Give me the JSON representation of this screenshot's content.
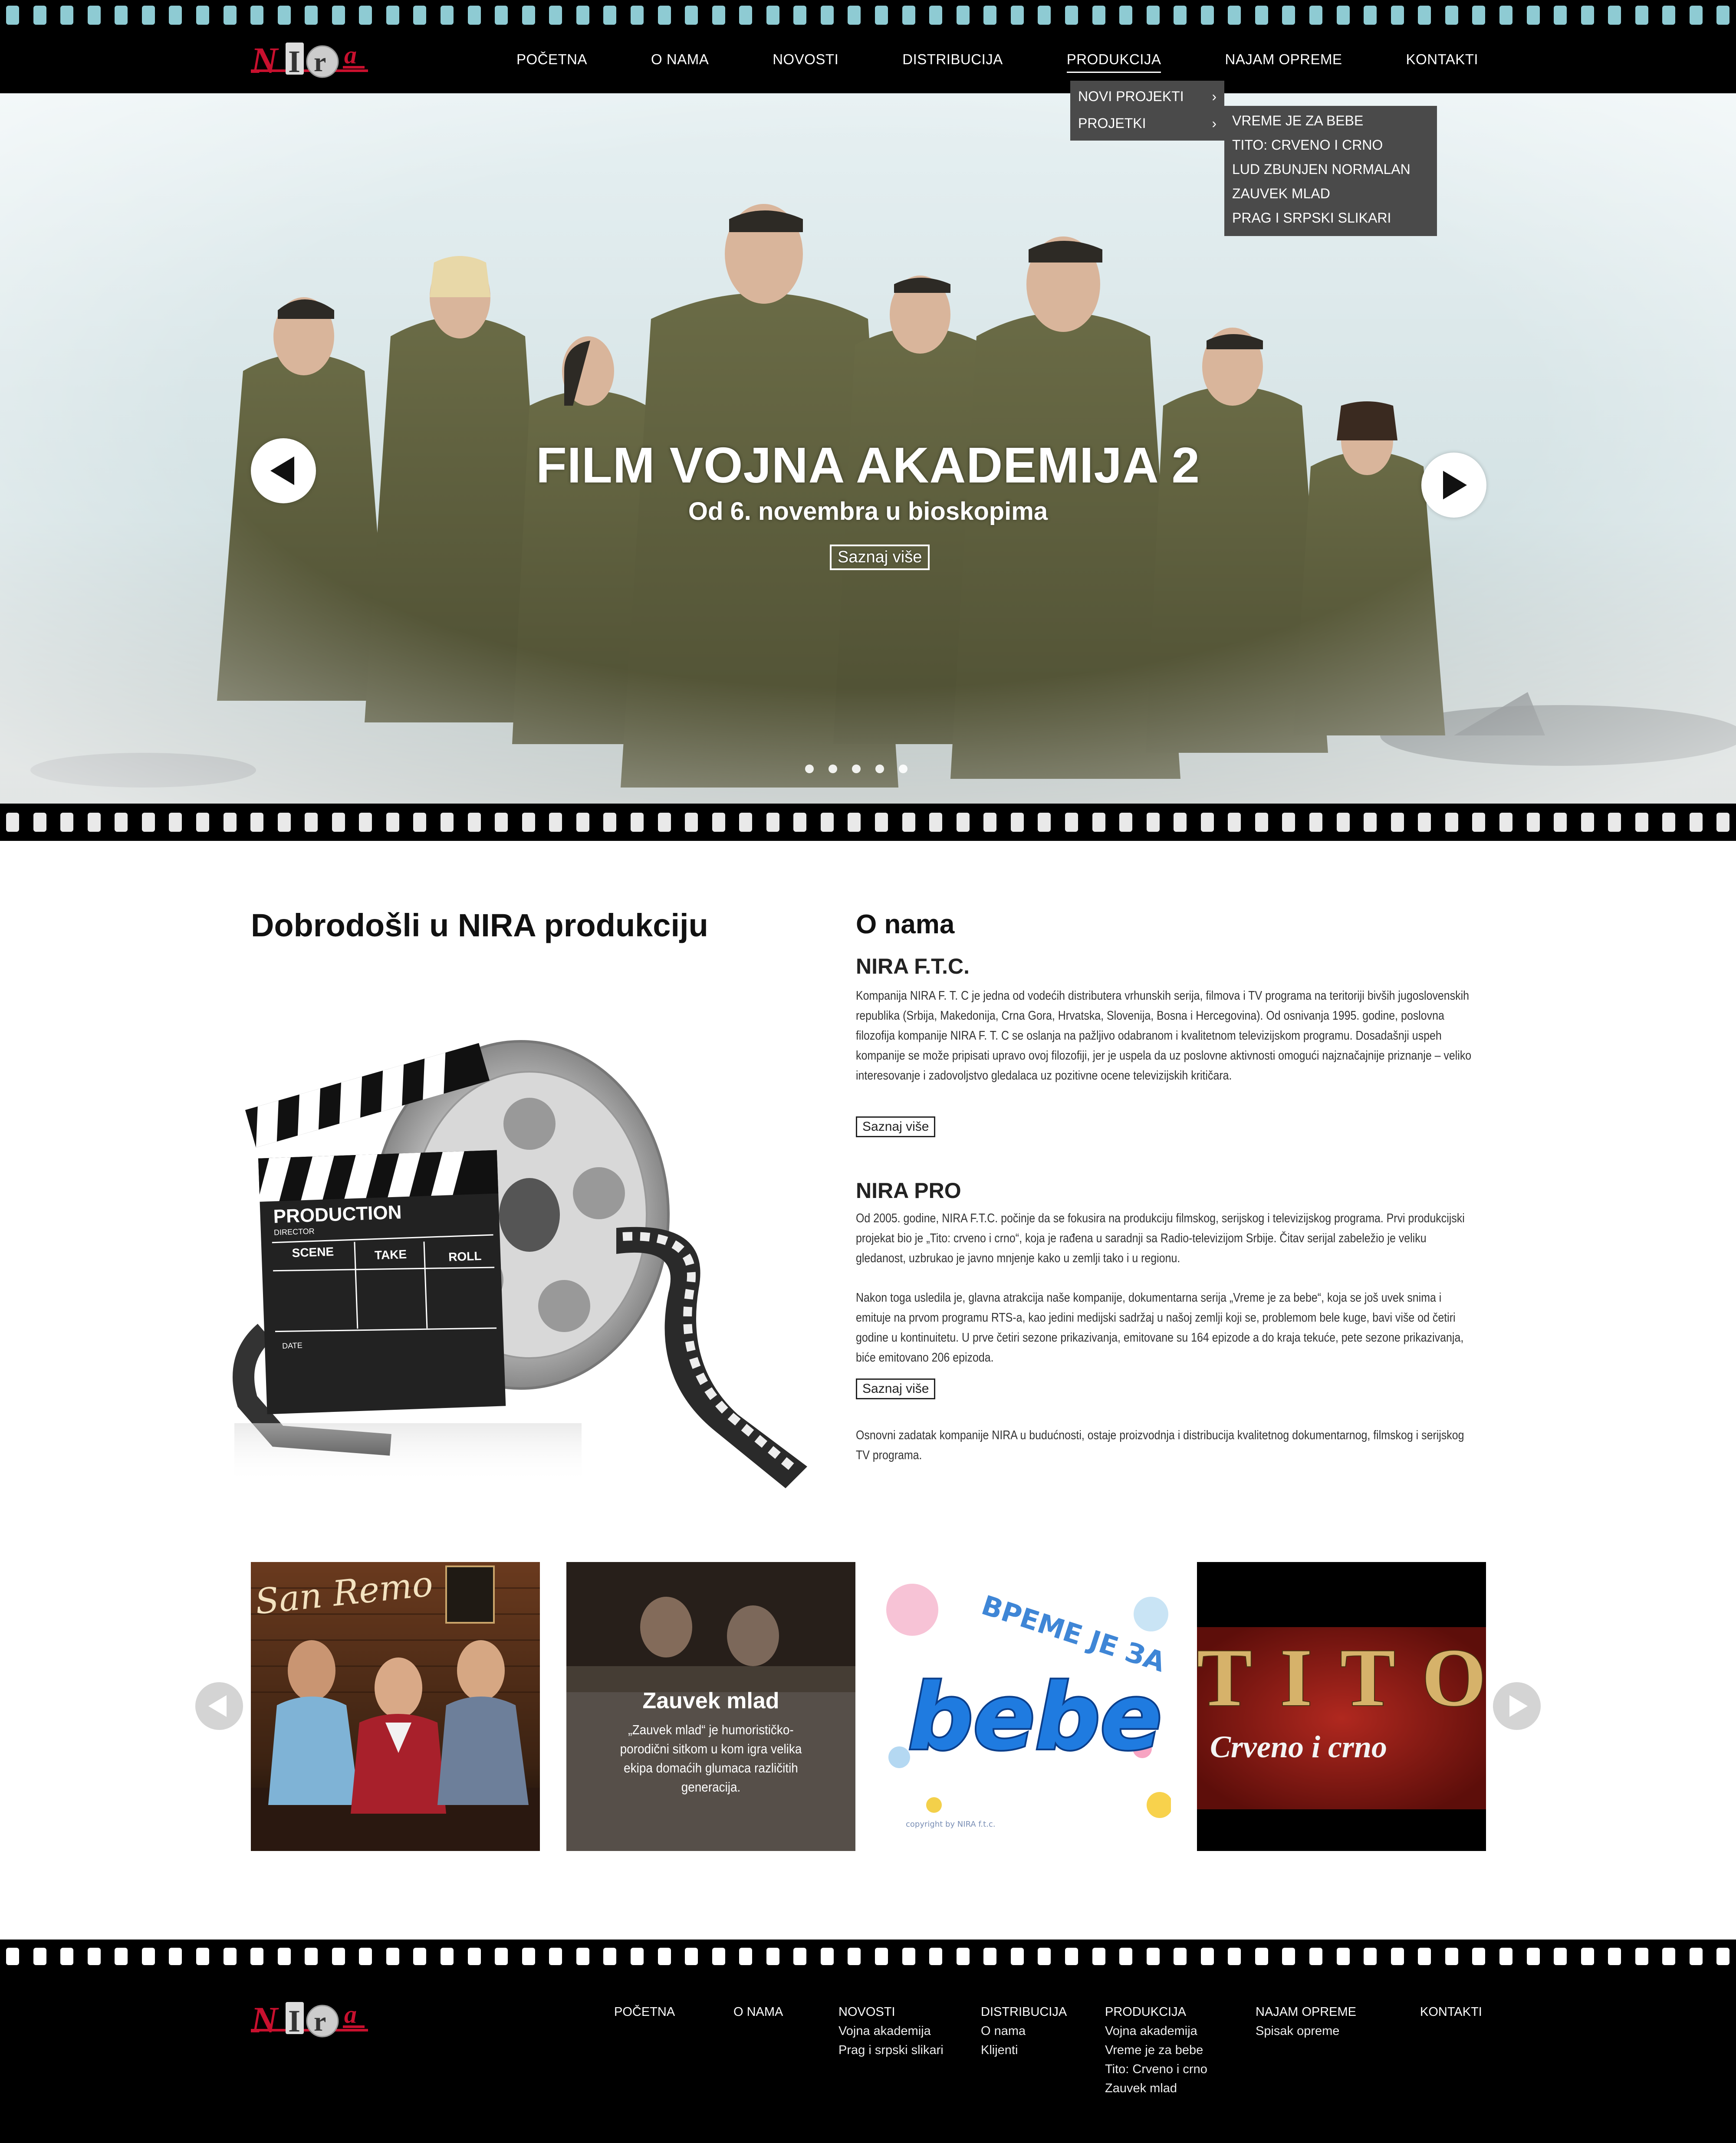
{
  "logo": {
    "text_n": "N",
    "text_i": "I",
    "text_r": "r",
    "text_a": "a"
  },
  "nav": [
    "POČETNA",
    "O NAMA",
    "NOVOSTI",
    "DISTRIBUCIJA",
    "PRODUKCIJA",
    "NAJAM OPREME",
    "KONTAKTI"
  ],
  "nav_active": "PRODUKCIJA",
  "dropdown": {
    "level1": [
      "NOVI PROJEKTI",
      "PROJETKI"
    ],
    "level2": [
      "VREME JE ZA BEBE",
      "TITO: CRVENO I CRNO",
      "LUD ZBUNJEN NORMALAN",
      "ZAUVEK MLAD",
      "PRAG I SRPSKI SLIKARI"
    ]
  },
  "hero": {
    "title": "FILM VOJNA AKADEMIJA 2",
    "subtitle": "Od 6. novembra u bioskopima",
    "button": "Saznaj više",
    "slides_total": 5,
    "active_slide": 1
  },
  "welcome": {
    "heading": "Dobrodošli u NIRA produkciju",
    "clapper_text": {
      "production": "PRODUCTION",
      "director": "DIRECTOR",
      "scene": "SCENE",
      "take": "TAKE",
      "roll": "ROLL",
      "date": "DATE"
    }
  },
  "about": {
    "heading": "O nama",
    "ftc_title": "NIRA F.T.C.",
    "ftc_text": "Kompanija NIRA F. T. C je jedna od vodećih distributera vrhunskih serija, filmova i TV programa na teritoriji bivših jugoslovenskih republika (Srbija, Makedonija, Crna Gora, Hrvatska, Slovenija, Bosna i Hercegovina). Od osnivanja 1995. godine, poslovna filozofija kompanije NIRA F. T. C se oslanja na pažljivo odabranom i kvalitetnom televizijskom programu. Dosadašnji uspeh kompanije se može pripisati upravo ovoj filozofiji, jer je uspela da uz poslovne aktivnosti omogući najznačajnije priznanje – veliko interesovanje i zadovoljstvo gledalaca uz pozitivne ocene televizijskih kritičara.",
    "ftc_button": "Saznaj više",
    "pro_title": "NIRA PRO",
    "pro_text1": "Od 2005. godine, NIRA F.T.C. počinje da se fokusira na produkciju filmskog, serijskog i televizijskog programa. Prvi produkcijski projekat bio je „Tito: crveno i crno“, koja je rađena u saradnji sa Radio-televizijom Srbije. Čitav serijal zabeležio je veliku gledanost, uzbrukao je javno mnjenje kako u zemlji tako i u regionu.",
    "pro_text2": "Nakon toga usledila je, glavna atrakcija naše kompanije, dokumentarna serija „Vreme je za bebe“, koja se još uvek snima i emituje na prvom programu RTS-a, kao jedini medijski sadržaj u našoj zemlji koji se, problemom bele kuge, bavi više od četiri godine u kontinuitetu. U prve četiri sezone prikazivanja, emitovane su 164 epizode a do kraja tekuće, pete sezone prikazivanja, biće emitovano 206 epizoda.",
    "pro_button": "Saznaj više",
    "pro_text3": "Osnovni zadatak kompanije NIRA u budućnosti, ostaje proizvodnja i distribucija kvalitetnog dokumentarnog, filmskog i serijskog TV programa."
  },
  "carousel": {
    "items": [
      {
        "sign": "San Remo"
      },
      {
        "title": "Zauvek mlad",
        "text": "„Zauvek mlad“ je humorističko-porodični sitkom u kom igra velika ekipa domaćih glumaca različitih generacija."
      },
      {
        "line1": "ВРЕМЕ ЈЕ ЗА",
        "line2": "bebe",
        "copyright": "copyright by NIRA f.t.c."
      },
      {
        "line1": "TITO",
        "line2": "Crveno i crno"
      }
    ]
  },
  "footer": {
    "columns": [
      {
        "head": "POČETNA",
        "links": []
      },
      {
        "head": "O NAMA",
        "links": []
      },
      {
        "head": "NOVOSTI",
        "links": [
          "Vojna akademija",
          "Prag i srpski slikari"
        ]
      },
      {
        "head": "DISTRIBUCIJA",
        "links": [
          "O nama",
          "Klijenti"
        ]
      },
      {
        "head": "PRODUKCIJA",
        "links": [
          "Vojna akademija",
          "Vreme je za bebe",
          "Tito: Crveno i crno",
          "Zauvek mlad"
        ]
      },
      {
        "head": "NAJAM OPREME",
        "links": [
          "Spisak opreme"
        ]
      },
      {
        "head": "KONTAKTI",
        "links": []
      }
    ]
  },
  "colors": {
    "accent_red": "#c8102e",
    "film_hole_top": "#8ecbd3",
    "dropdown_bg": "#4a4a4a"
  }
}
